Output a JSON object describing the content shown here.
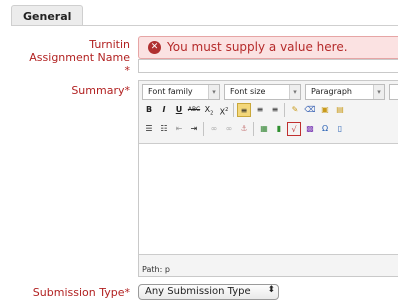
{
  "section": {
    "title": "General"
  },
  "fields": {
    "assignment_name": {
      "label_line1": "Turnitin",
      "label_line2": "Assignment Name",
      "required_mark": "*",
      "error_icon": "x-circle-icon",
      "error_text": "You must supply a value here.",
      "value": ""
    },
    "summary": {
      "label": "Summary",
      "required_mark": "*",
      "font_family": "Font family",
      "font_size": "Font size",
      "format": "Paragraph",
      "bold": "B",
      "italic": "I",
      "underline": "U",
      "strike": "ABC",
      "subscript": "X",
      "superscript": "X",
      "path_label": "Path: p"
    },
    "submission_type": {
      "label": "Submission Type",
      "required_mark": "*",
      "value": "Any Submission Type",
      "arrows": "⬍"
    }
  },
  "colors": {
    "label_red": "#b22222",
    "error_bg": "#fbe2e2",
    "error_text": "#b52a2a"
  }
}
